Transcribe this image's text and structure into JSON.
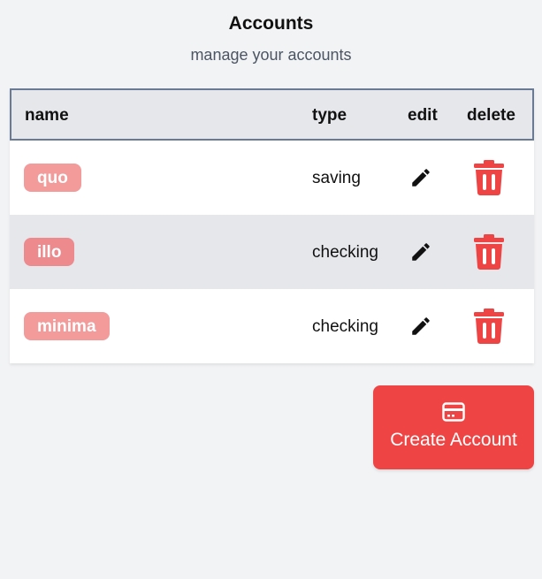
{
  "header": {
    "title": "Accounts",
    "subtitle": "manage your accounts"
  },
  "table": {
    "columns": [
      "name",
      "type",
      "edit",
      "delete"
    ],
    "rows": [
      {
        "name": "quo",
        "type": "saving"
      },
      {
        "name": "illo",
        "type": "checking"
      },
      {
        "name": "minima",
        "type": "checking"
      }
    ]
  },
  "create_button": {
    "label": "Create Account",
    "icon": "credit-card-icon"
  },
  "icons": {
    "edit": "pencil-icon",
    "delete": "trash-icon"
  },
  "colors": {
    "accent": "#ef4444",
    "badge": "#f39a9a",
    "header_bg": "#e5e7eb"
  }
}
